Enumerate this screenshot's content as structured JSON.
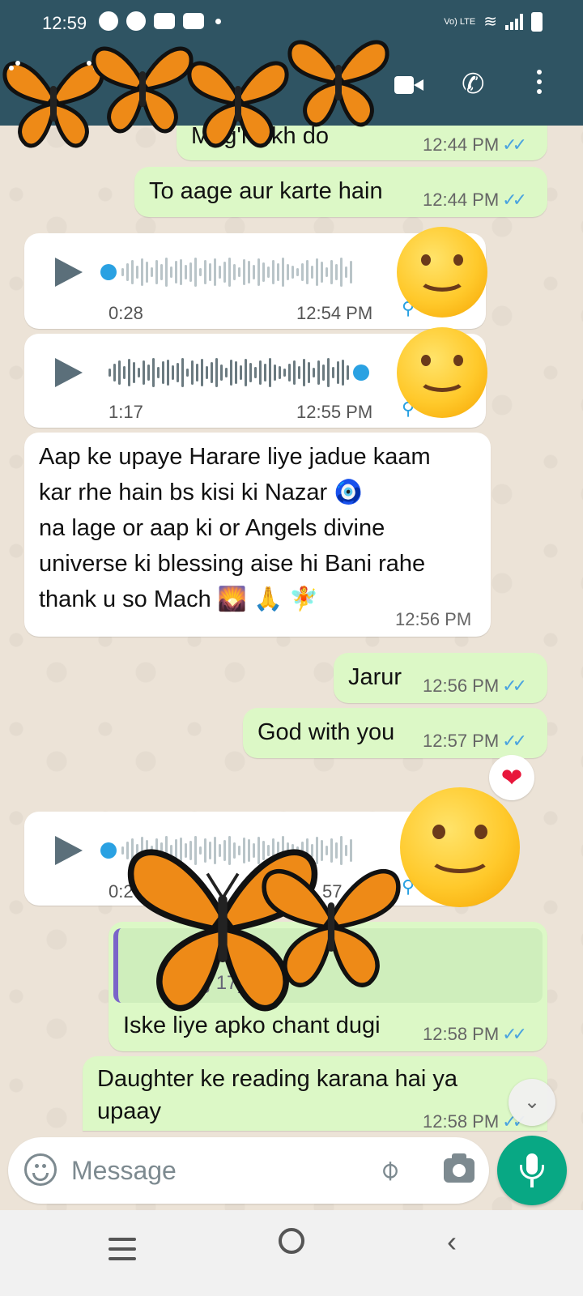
{
  "status_bar": {
    "time": "12:59",
    "network_label": "Vo) LTE"
  },
  "app_bar": {
    "icons": [
      "video-call-icon",
      "voice-call-icon",
      "more-options-icon"
    ]
  },
  "messages": [
    {
      "id": "m1",
      "direction": "out",
      "text": "Mag'n likh do",
      "time": "12:44 PM",
      "status": "read"
    },
    {
      "id": "m2",
      "direction": "out",
      "text": "To aage aur karte hain",
      "time": "12:44 PM",
      "status": "read"
    },
    {
      "id": "m3",
      "direction": "in",
      "type": "voice",
      "duration": "0:28",
      "time": "12:54 PM",
      "progress": 0.0
    },
    {
      "id": "m4",
      "direction": "in",
      "type": "voice",
      "duration": "1:17",
      "time": "12:55 PM",
      "progress": 1.0
    },
    {
      "id": "m5",
      "direction": "in",
      "lines": [
        "Aap ke upaye Harare liye jadue kaam",
        "kar rhe hain bs kisi ki Nazar 🧿",
        "na lage or aap ki or Angels divine",
        "universe ki blessing aise hi Bani rahe",
        "thank u so Mach 🌄 🙏 🧚"
      ],
      "time": "12:56 PM"
    },
    {
      "id": "m6",
      "direction": "out",
      "text": "Jarur",
      "time": "12:56 PM",
      "status": "read"
    },
    {
      "id": "m7",
      "direction": "out",
      "text": "God with you",
      "time": "12:57 PM",
      "status": "read",
      "reaction": "❤"
    },
    {
      "id": "m8",
      "direction": "in",
      "type": "voice",
      "duration": "0:2",
      "time": "57",
      "progress": 0.0
    },
    {
      "id": "m9",
      "direction": "out",
      "quote": "ice ag 17)",
      "text": "Iske liye apko chant dugi",
      "time": "12:58 PM",
      "status": "read"
    },
    {
      "id": "m10",
      "direction": "out",
      "lines": [
        "Daughter ke reading karana hai ya",
        "upaay"
      ],
      "time": "12:58 PM",
      "status": "read"
    }
  ],
  "composer": {
    "placeholder": "Message"
  },
  "colors": {
    "header": "#2f5463",
    "outgoing_bubble": "#dcf8c6",
    "incoming_bubble": "#ffffff",
    "read_ticks": "#4aa3df",
    "mic_button": "#08a884"
  }
}
